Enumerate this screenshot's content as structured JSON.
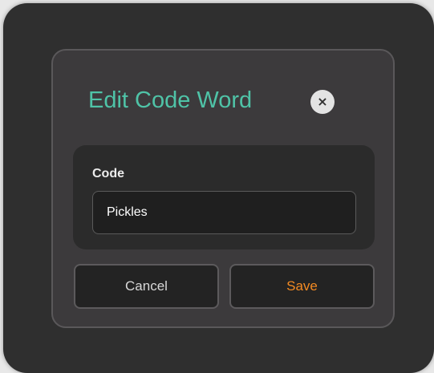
{
  "dialog": {
    "title": "Edit Code Word",
    "close_icon": "close-icon",
    "close_glyph": "×"
  },
  "form": {
    "code_label": "Code",
    "code_value": "Pickles"
  },
  "actions": {
    "cancel_label": "Cancel",
    "save_label": "Save"
  },
  "colors": {
    "backdrop": "#2f2f2f",
    "dialog_bg": "#3c3a3c",
    "title": "#4fc3a7",
    "save_text": "#f28a23",
    "panel_bg": "#2b2b2b"
  }
}
